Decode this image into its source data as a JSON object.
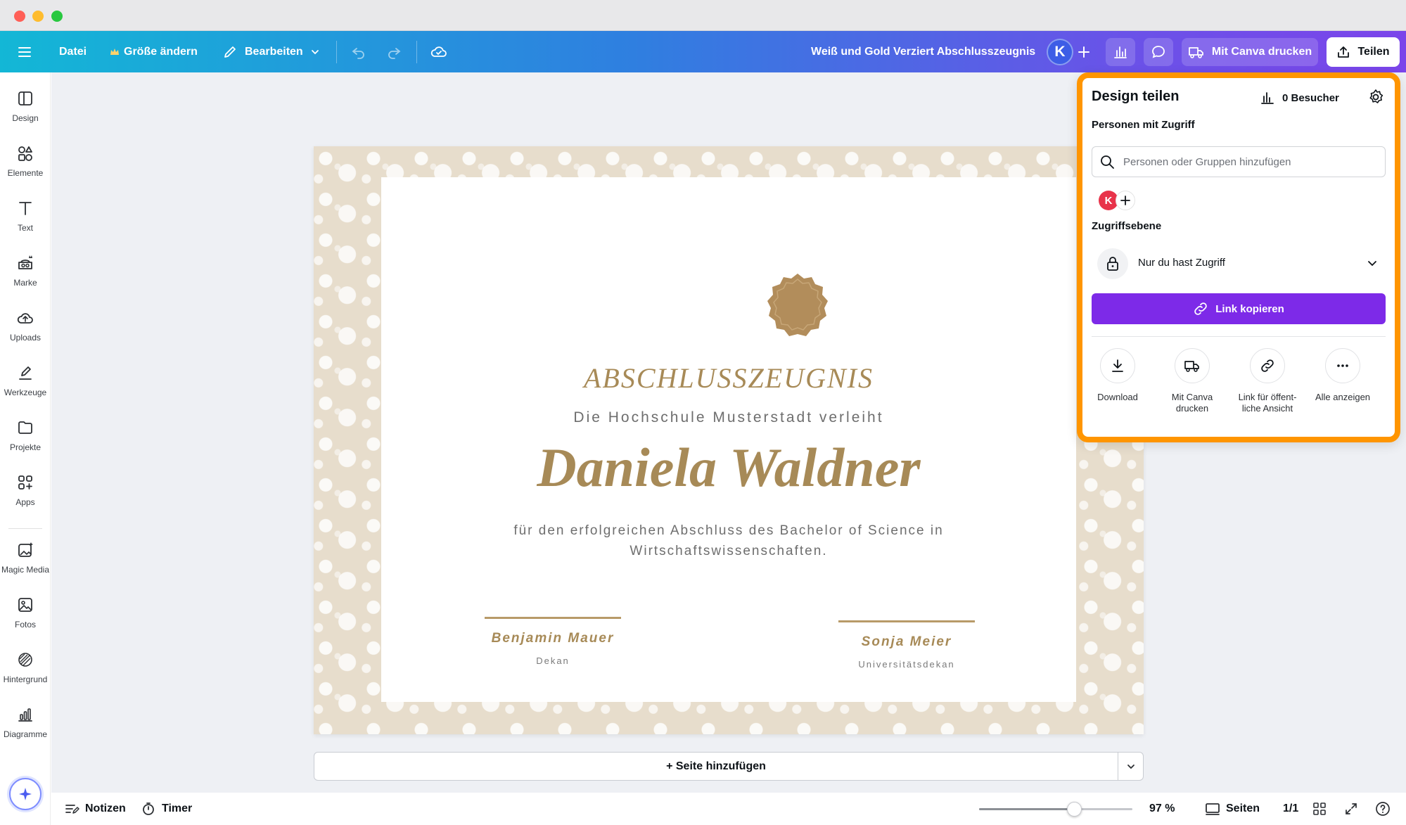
{
  "toolbar": {
    "file": "Datei",
    "resize": "Größe ändern",
    "edit": "Bearbeiten",
    "doc_title": "Weiß und Gold Verziert Abschlusszeugnis",
    "avatar_initial": "K",
    "print": "Mit Canva drucken",
    "share": "Teilen"
  },
  "sidebar": {
    "items": [
      {
        "label": "Design",
        "icon": "layout-icon"
      },
      {
        "label": "Elemente",
        "icon": "shapes-icon"
      },
      {
        "label": "Text",
        "icon": "text-icon"
      },
      {
        "label": "Marke",
        "icon": "brand-icon"
      },
      {
        "label": "Uploads",
        "icon": "cloud-upload-icon"
      },
      {
        "label": "Werkzeuge",
        "icon": "pen-tool-icon"
      },
      {
        "label": "Projekte",
        "icon": "folder-icon"
      },
      {
        "label": "Apps",
        "icon": "apps-grid-icon"
      },
      {
        "label": "Magic Media",
        "icon": "magic-media-icon"
      },
      {
        "label": "Fotos",
        "icon": "photo-icon"
      },
      {
        "label": "Hintergrund",
        "icon": "background-pattern-icon"
      },
      {
        "label": "Diagramme",
        "icon": "chart-icon"
      }
    ]
  },
  "certificate": {
    "title": "ABSCHLUSSZEUGNIS",
    "subtitle": "Die Hochschule Musterstadt verleiht",
    "name": "Daniela Waldner",
    "description": "für den erfolgreichen Abschluss des Bachelor of Science in Wirtschaftswissenschaften.",
    "signer1_name": "Benjamin Mauer",
    "signer1_role": "Dekan",
    "signer2_name": "Sonja Meier",
    "signer2_role": "Universitätsdekan",
    "border_color": "#e7ddcc",
    "gold": "#a78a57"
  },
  "canvas": {
    "add_page": "+ Seite hinzufügen"
  },
  "bottombar": {
    "notes": "Notizen",
    "timer": "Timer",
    "zoom": "97 %",
    "zoom_level": 0.62,
    "pages_label": "Seiten",
    "page_count": "1/1"
  },
  "share_panel": {
    "title": "Design teilen",
    "visitors": "0 Besucher",
    "people_heading": "Personen mit Zugriff",
    "search_placeholder": "Personen oder Gruppen hinzufügen",
    "user_initial": "K",
    "access_heading": "Zugriffsebene",
    "access_value": "Nur du hast Zugriff",
    "copy_link": "Link kopieren",
    "actions": [
      {
        "label": "Download",
        "icon": "download-icon"
      },
      {
        "label": "Mit Canva drucken",
        "icon": "truck-icon"
      },
      {
        "label": "Link für öffent-liche Ansicht",
        "icon": "link-icon"
      },
      {
        "label": "Alle anzeigen",
        "icon": "more-icon"
      }
    ],
    "highlight_color": "#ff9500",
    "button_color": "#7d2ae8"
  }
}
